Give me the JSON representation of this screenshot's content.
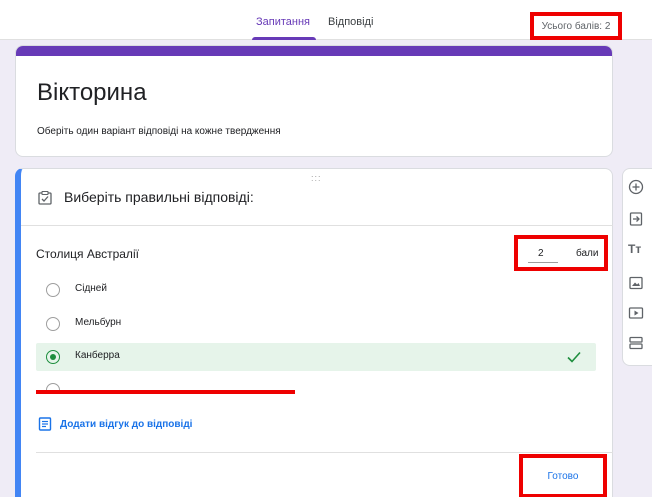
{
  "tabs": [
    {
      "label": "Запитання",
      "active": true
    },
    {
      "label": "Відповіді",
      "active": false
    }
  ],
  "total_score": "Усього балів: 2",
  "quiz": {
    "title": "Вікторина",
    "description": "Оберіть один варіант відповіді на кожне твердження"
  },
  "question_card": {
    "drag_handle": ":::",
    "section_title": "Виберіть правильні відповіді:",
    "question": "Столиця Австралії",
    "points_value": "2",
    "points_unit": "бали",
    "options": [
      {
        "label": "Сідней",
        "selected": false,
        "correct": false
      },
      {
        "label": "Мельбурн",
        "selected": false,
        "correct": false
      },
      {
        "label": "Канберра",
        "selected": true,
        "correct": true
      }
    ],
    "feedback_link": "Додати відгук до відповіді",
    "done_label": "Готово"
  },
  "colors": {
    "accent": "#673ab7",
    "link": "#1a73e8",
    "correct": "#1e8e3e",
    "highlight": "#ee0000"
  },
  "toolbar_icons": [
    "add-question-icon",
    "import-questions-icon",
    "add-title-icon",
    "add-image-icon",
    "add-video-icon",
    "add-section-icon"
  ]
}
